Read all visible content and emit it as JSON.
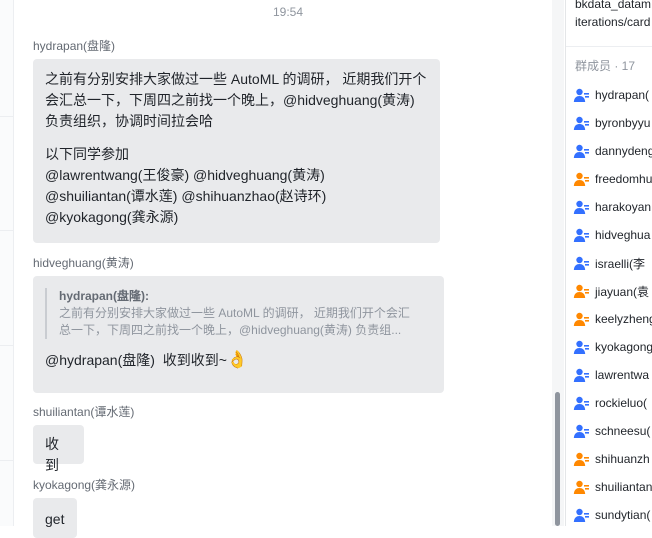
{
  "chat": {
    "timestamp": "19:54",
    "messages": [
      {
        "sender": "hydrapan(盘隆)",
        "lines": [
          "之前有分别安排大家做过一些 AutoML 的调研， 近期我们开个",
          "会汇总一下，下周四之前找一个晚上，@hidveghuang(黄涛)",
          "负责组织，协调时间拉会哈",
          "",
          "以下同学参加",
          "@lawrentwang(王俊豪) @hidveghuang(黄涛)",
          "@shuiliantan(谭水莲) @shihuanzhao(赵诗环)",
          "@kyokagong(龚永源)"
        ]
      },
      {
        "sender": "hidveghuang(黄涛)",
        "quote_sender": "hydrapan(盘隆):",
        "quote_lines": [
          "之前有分别安排大家做过一些 AutoML 的调研， 近期我们开个会汇",
          "总一下，下周四之前找一个晚上，@hidveghuang(黄涛)  负责组..."
        ],
        "text": "@hydrapan(盘隆)  收到收到~",
        "emoji": "👌"
      },
      {
        "sender": "shuiliantan(谭水莲)",
        "text": "收到"
      },
      {
        "sender": "kyokagong(龚永源)",
        "text": "get"
      }
    ]
  },
  "panel": {
    "link_line1": "bkdata_datam",
    "link_line2": "iterations/card",
    "members_header": "群成员 · 17",
    "members": [
      {
        "name": "hydrapan(",
        "color": "#3370ff"
      },
      {
        "name": "byronbyyu",
        "color": "#3370ff"
      },
      {
        "name": "dannydeng",
        "color": "#3370ff"
      },
      {
        "name": "freedomhu",
        "color": "#ff8800"
      },
      {
        "name": "harakoyan",
        "color": "#3370ff"
      },
      {
        "name": "hidveghua",
        "color": "#3370ff"
      },
      {
        "name": "israelli(李",
        "color": "#3370ff"
      },
      {
        "name": "jiayuan(袁",
        "color": "#ff8800"
      },
      {
        "name": "keelyzheng",
        "color": "#ff8800"
      },
      {
        "name": "kyokagong",
        "color": "#3370ff"
      },
      {
        "name": "lawrentwa",
        "color": "#3370ff"
      },
      {
        "name": "rockieluo(",
        "color": "#3370ff"
      },
      {
        "name": "schneesu(",
        "color": "#3370ff"
      },
      {
        "name": "shihuanzh",
        "color": "#ff8800"
      },
      {
        "name": "shuiliantan",
        "color": "#ff8800"
      },
      {
        "name": "sundytian(",
        "color": "#3370ff"
      }
    ]
  }
}
